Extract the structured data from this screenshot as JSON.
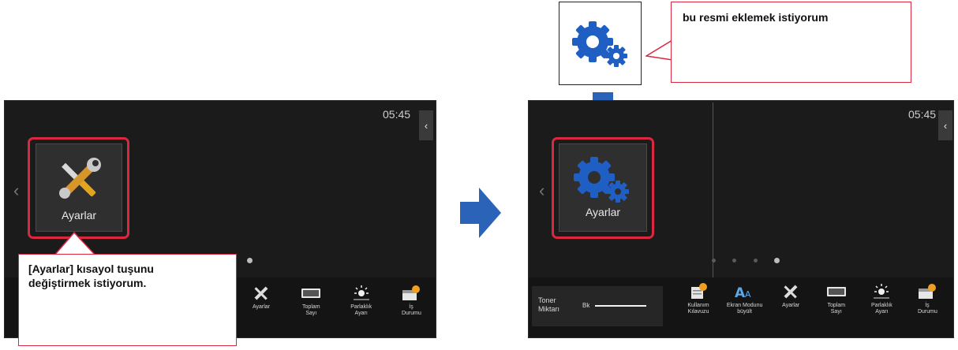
{
  "left_screen": {
    "time": "05:45",
    "tile_label": "Ayarlar",
    "callout_text": "[Ayarlar] kısayol tuşunu değiştirmek istiyorum.",
    "bottom_items": [
      {
        "icon": "wrench-screwdriver-icon",
        "label": "Ayarlar"
      },
      {
        "icon": "counter-icon",
        "label": "Toplam Sayı"
      },
      {
        "icon": "brightness-icon",
        "label": "Parlaklık Ayarı"
      },
      {
        "icon": "job-status-icon",
        "label": "İş Durumu"
      }
    ]
  },
  "right_screen": {
    "time": "05:45",
    "tile_label": "Ayarlar",
    "toner_label": "Toner Miktarı",
    "toner_color": "Bk",
    "bottom_items": [
      {
        "icon": "user-guide-icon",
        "label": "Kullanım Kılavuzu"
      },
      {
        "icon": "enlarge-display-icon",
        "label": "Ekran Modunu büyült"
      },
      {
        "icon": "wrench-screwdriver-icon",
        "label": "Ayarlar"
      },
      {
        "icon": "counter-icon",
        "label": "Toplam Sayı"
      },
      {
        "icon": "brightness-icon",
        "label": "Parlaklık Ayarı"
      },
      {
        "icon": "job-status-icon",
        "label": "İş Durumu"
      }
    ]
  },
  "new_icon_callout": {
    "text": "bu resmi eklemek istiyorum",
    "icon": "gears-icon"
  },
  "colors": {
    "accent_red": "#d9283f",
    "arrow_blue": "#2a63b8",
    "gear_blue": "#1f5fc4",
    "screen_bg": "#1b1b1b"
  }
}
